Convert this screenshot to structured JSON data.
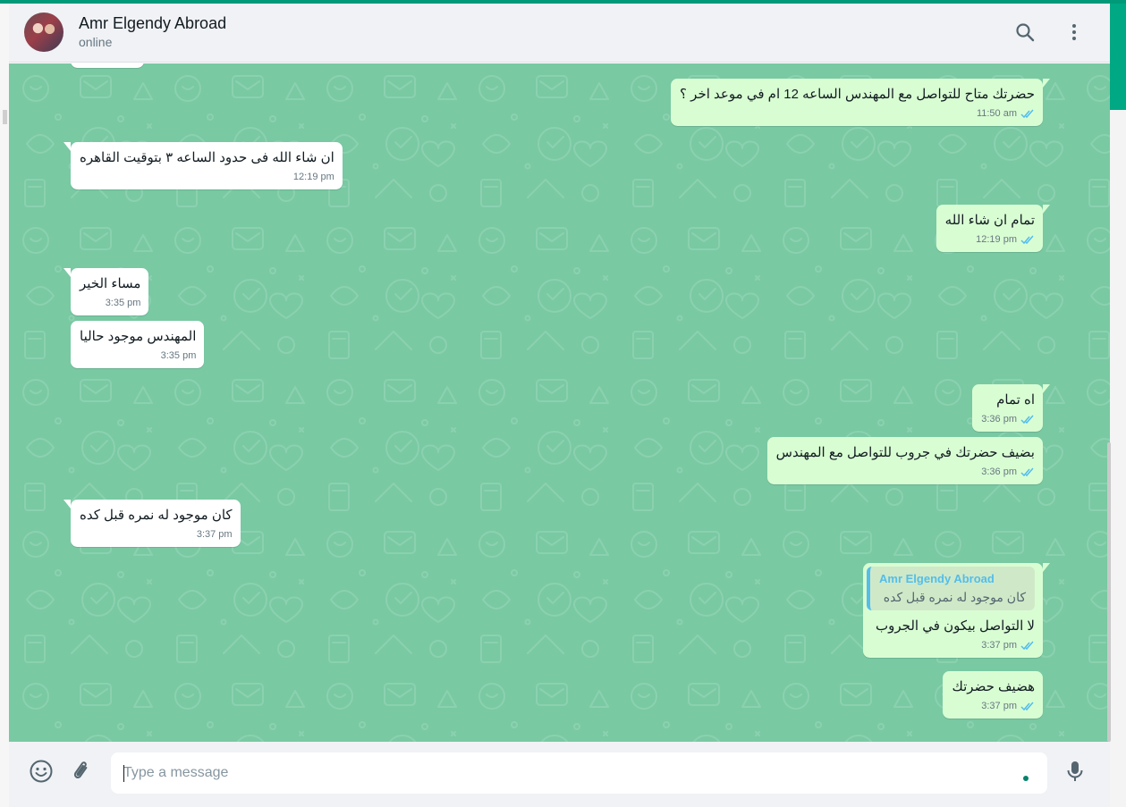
{
  "contact": {
    "name": "Amr Elgendy Abroad",
    "status": "online"
  },
  "messages": [
    {
      "direction": "out",
      "text": "حضرتك متاح للتواصل مع المهندس الساعه 12 ام في موعد اخر ؟",
      "time": "11:50 am",
      "read": true
    },
    {
      "direction": "in",
      "text": "ان شاء الله فى حدود الساعه ٣ بتوقيت القاهره",
      "time": "12:19 pm"
    },
    {
      "direction": "out",
      "text": "تمام ان شاء الله",
      "time": "12:19 pm",
      "read": true
    },
    {
      "direction": "in",
      "text": "مساء الخير",
      "time": "3:35 pm"
    },
    {
      "direction": "in",
      "text": "المهندس موجود حاليا",
      "time": "3:35 pm"
    },
    {
      "direction": "out",
      "text": "اه تمام",
      "time": "3:36 pm",
      "read": true
    },
    {
      "direction": "out",
      "text": "بضيف حضرتك في جروب للتواصل مع المهندس",
      "time": "3:36 pm",
      "read": true
    },
    {
      "direction": "in",
      "text": "كان موجود له نمره قبل كده",
      "time": "3:37 pm"
    },
    {
      "direction": "out",
      "text": "لا التواصل بيكون في الجروب",
      "time": "3:37 pm",
      "read": true,
      "quote": {
        "author": "Amr Elgendy Abroad",
        "text": "كان موجود له نمره قبل كده"
      }
    },
    {
      "direction": "out",
      "text": "هضيف حضرتك",
      "time": "3:37 pm",
      "read": true
    }
  ],
  "composer": {
    "placeholder": "Type a message",
    "value": ""
  },
  "icons": {
    "search": "search-icon",
    "menu": "menu-icon",
    "emoji": "emoji-icon",
    "attach": "attach-icon",
    "mic": "mic-icon",
    "read_receipt": "double-check-icon"
  },
  "colors": {
    "brand": "#00a884",
    "incoming_bubble": "#ffffff",
    "outgoing_bubble": "#d9fdd3",
    "read_tick": "#53bdeb",
    "wallpaper": "#79c9a3"
  }
}
